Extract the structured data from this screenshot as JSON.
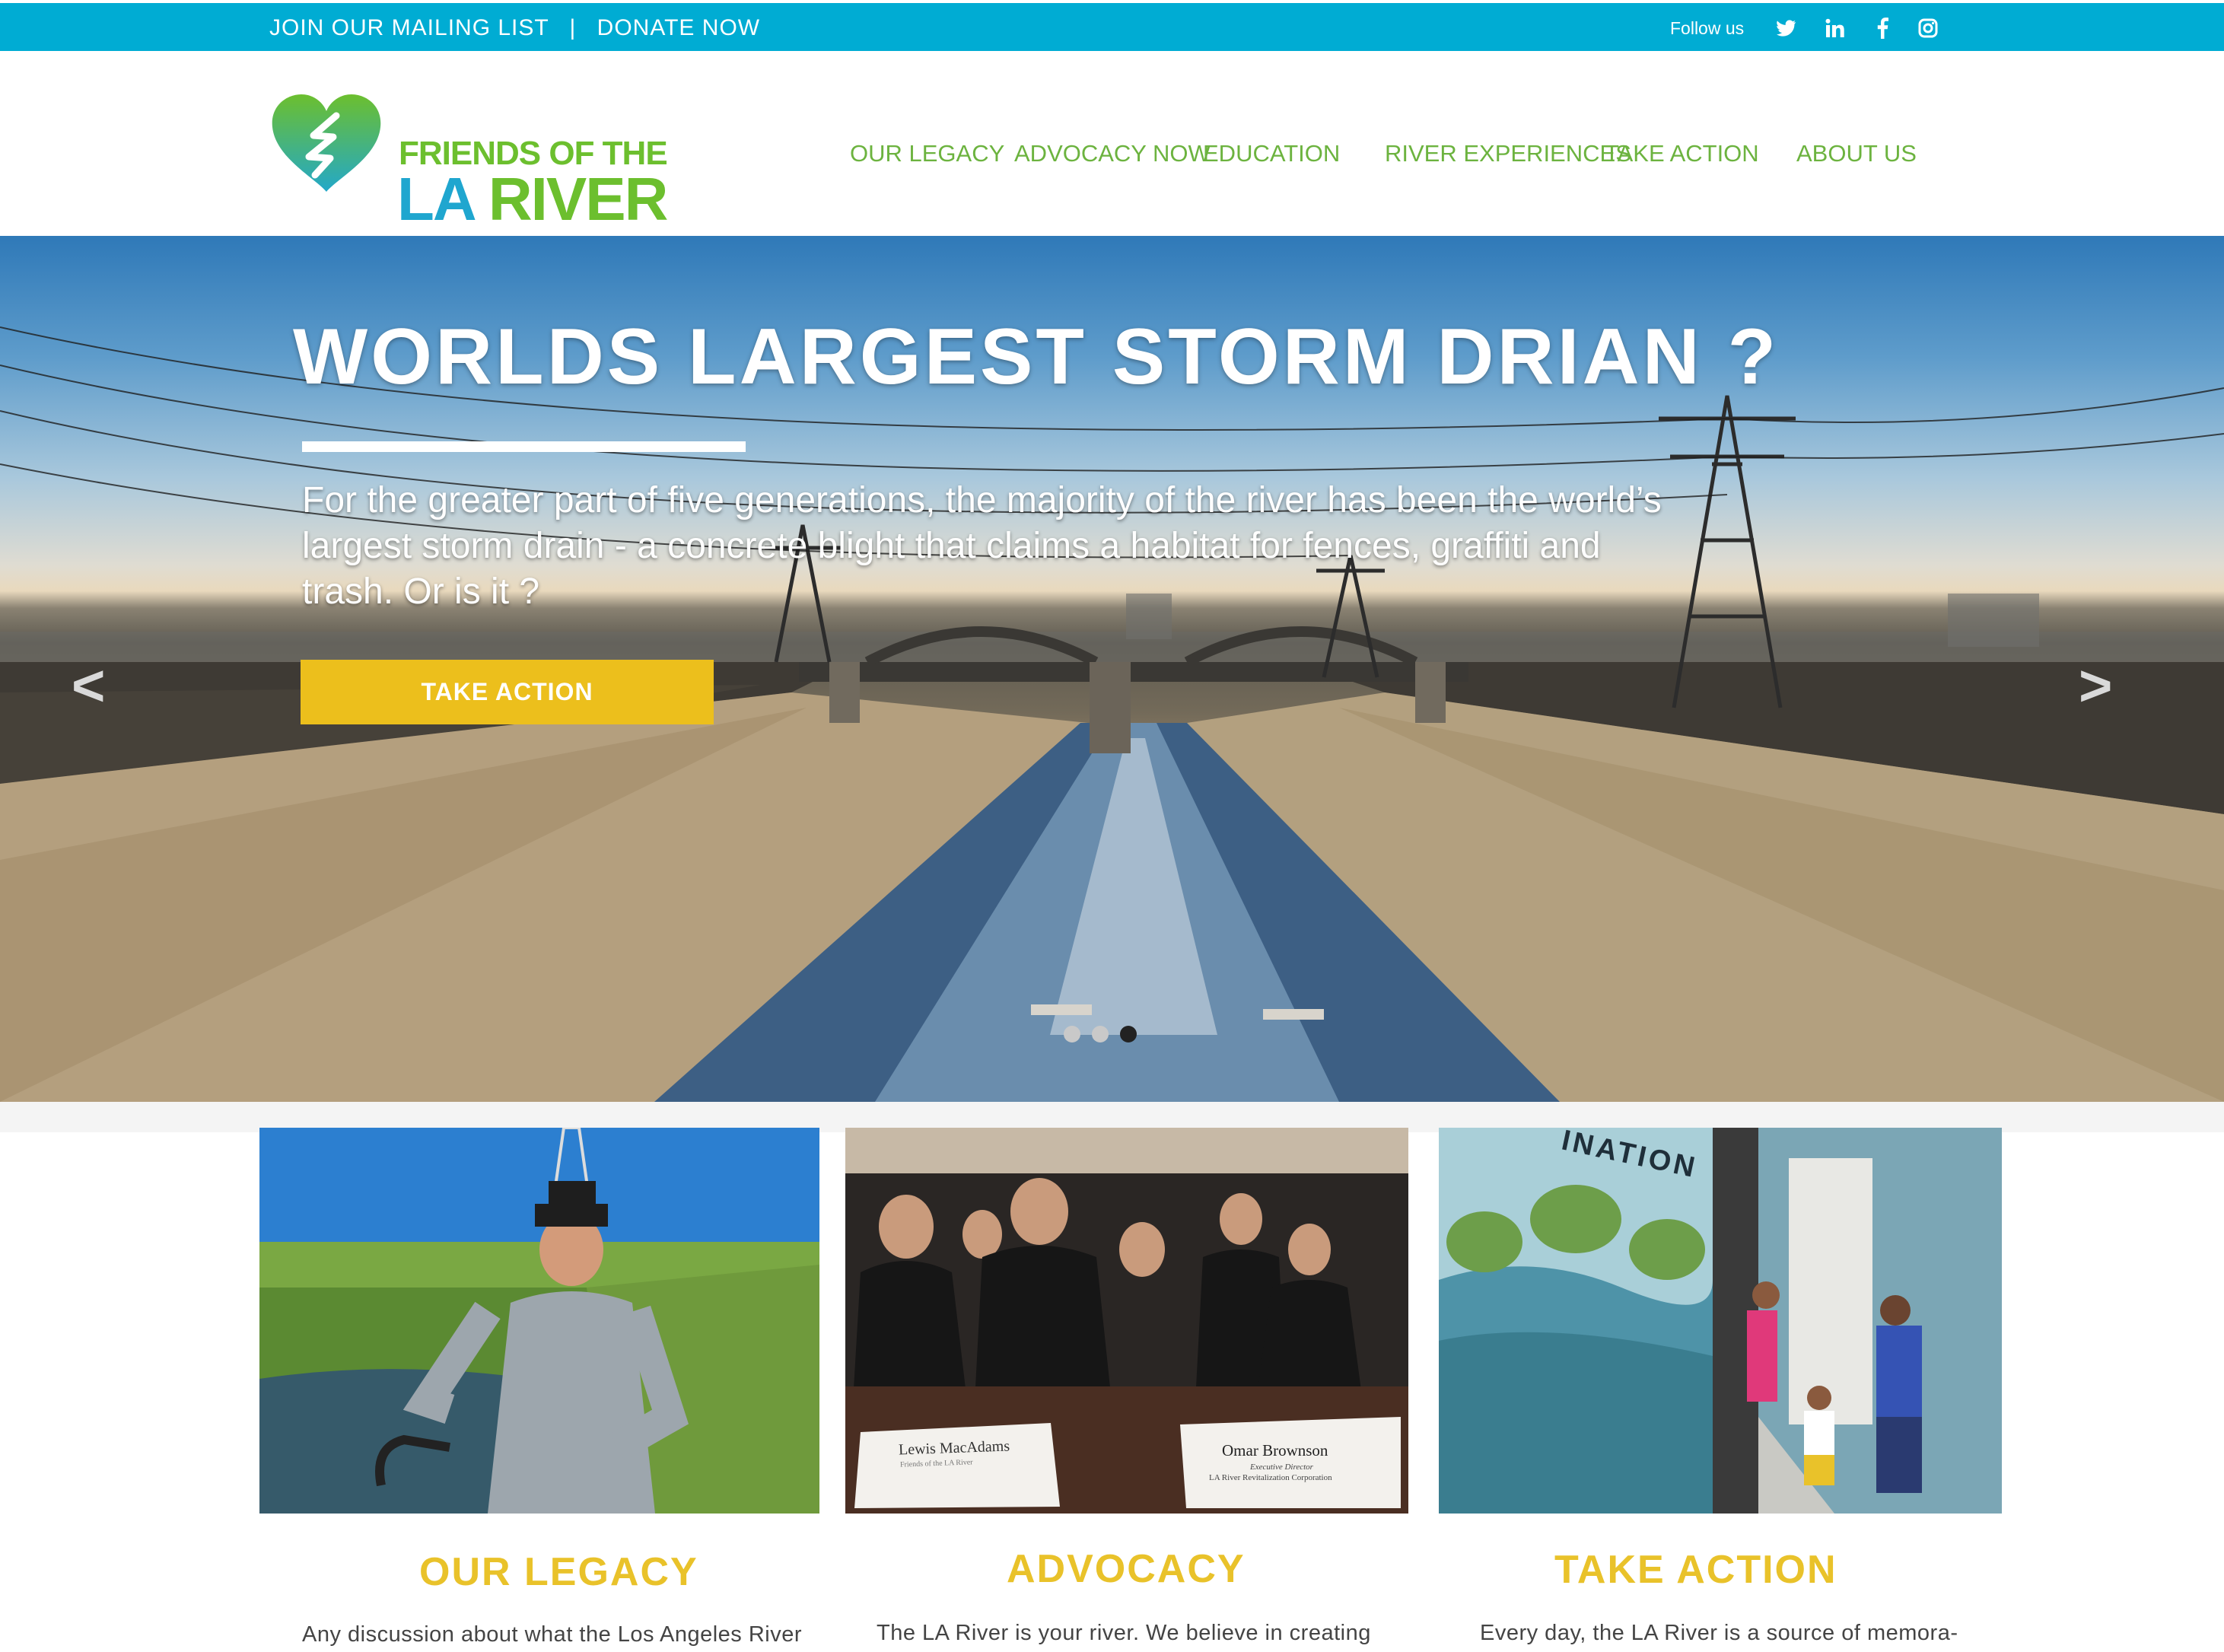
{
  "topbar": {
    "mailing_label": "JOIN OUR MAILING LIST",
    "separator": "|",
    "donate_label": "DONATE NOW",
    "follow_label": "Follow us",
    "social": [
      {
        "name": "twitter-icon",
        "glyph": "t"
      },
      {
        "name": "linkedin-icon",
        "glyph": "in"
      },
      {
        "name": "facebook-icon",
        "glyph": "f"
      },
      {
        "name": "instagram-icon",
        "glyph": "◻"
      }
    ]
  },
  "logo": {
    "line1": "FRIENDS OF THE",
    "line2_la": "LA",
    "line2_river": "RIVER"
  },
  "nav": {
    "our_legacy": "OUR LEGACY",
    "advocacy_now": "ADVOCACY NOW",
    "education": "EDUCATION",
    "river_experiences": "RIVER EXPERIENCES",
    "take_action": "TAKE ACTION",
    "about_us": "ABOUT US"
  },
  "hero": {
    "title": "WORLDS LARGEST STORM DRIAN ?",
    "body": "For the greater part of five generations, the majority of the river has been the world’s largest storm drain - a concrete blight that claims a habitat for fences, graffiti and trash. Or is it ?",
    "cta": "TAKE ACTION",
    "prev_arrow": "<",
    "next_arrow": ">"
  },
  "cards": [
    {
      "title": "OUR LEGACY",
      "body": "Any discussion about what the Los Angeles River"
    },
    {
      "title": "ADVOCACY",
      "body": "The LA River is your river. We believe in creating",
      "placard_left_name": "Lewis MacAdams",
      "placard_left_sub": "Friends of the LA River",
      "placard_right_name": "Omar Brownson",
      "placard_right_title": "Executive Director",
      "placard_right_org": "LA River Revitalization Corporation"
    },
    {
      "title": "TAKE ACTION",
      "body": "Every day, the LA River is a source of memora-",
      "mural_text": "INATION"
    }
  ],
  "colors": {
    "topbar": "#00acd3",
    "nav_green": "#6cb33f",
    "logo_green": "#6cbf2e",
    "logo_blue": "#1fa6cf",
    "accent_yellow": "#ecbf1c",
    "card_title_yellow": "#e9c22a"
  }
}
